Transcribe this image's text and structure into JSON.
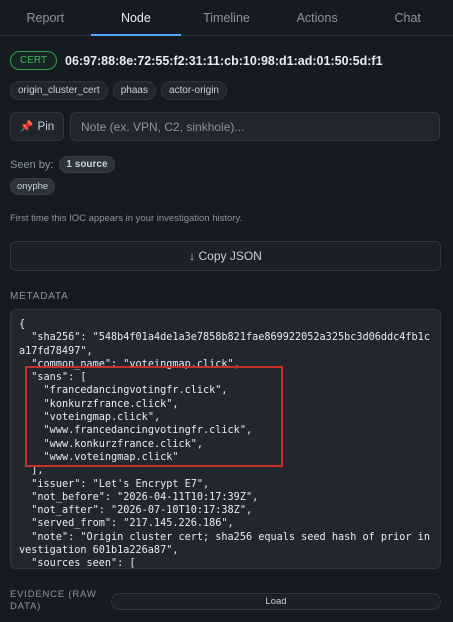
{
  "tabs": [
    {
      "label": "Report"
    },
    {
      "label": "Node"
    },
    {
      "label": "Timeline"
    },
    {
      "label": "Actions"
    },
    {
      "label": "Chat"
    }
  ],
  "active_tab": "Node",
  "node": {
    "type_badge": "CERT",
    "hash": "06:97:88:8e:72:55:f2:31:11:cb:10:98:d1:ad:01:50:5d:f1",
    "tags": [
      "origin_cluster_cert",
      "phaas",
      "actor-origin"
    ]
  },
  "note": {
    "pin_label": "Pin",
    "placeholder": "Note (ex. VPN, C2, sinkhole)..."
  },
  "seen_by": {
    "label": "Seen by:",
    "count_badge": "1 source",
    "sources": [
      "onyphe"
    ]
  },
  "first_time_text": "First time this IOC appears in your investigation history.",
  "copy_json_label": "↓ Copy JSON",
  "metadata": {
    "title": "METADATA",
    "json_text": "{\n  \"sha256\": \"548b4f01a4de1a3e7858b821fae869922052a325bc3d06ddc4fb1ca17fd78497\",\n  \"common_name\": \"voteingmap.click\",\n  \"sans\": [\n    \"francedancingvotingfr.click\",\n    \"konkurzfrance.click\",\n    \"voteingmap.click\",\n    \"www.francedancingvotingfr.click\",\n    \"www.konkurzfrance.click\",\n    \"www.voteingmap.click\"\n  ],\n  \"issuer\": \"Let's Encrypt E7\",\n  \"not_before\": \"2026-04-11T10:17:39Z\",\n  \"not_after\": \"2026-07-10T10:17:38Z\",\n  \"served_from\": \"217.145.226.186\",\n  \"note\": \"Origin cluster cert; sha256 equals seed hash of prior investigation 601b1a226a87\",\n  \"sources_seen\": [\n    \"onyphe\"\n  ]\n}"
  },
  "evidence": {
    "label": "EVIDENCE (RAW DATA)",
    "load_label": "Load"
  },
  "colors": {
    "background": "#161b22",
    "accent": "#58a6ff",
    "cert_green": "#3fb950",
    "highlight_red": "#c9302c",
    "pin_pink": "#f778ba"
  }
}
